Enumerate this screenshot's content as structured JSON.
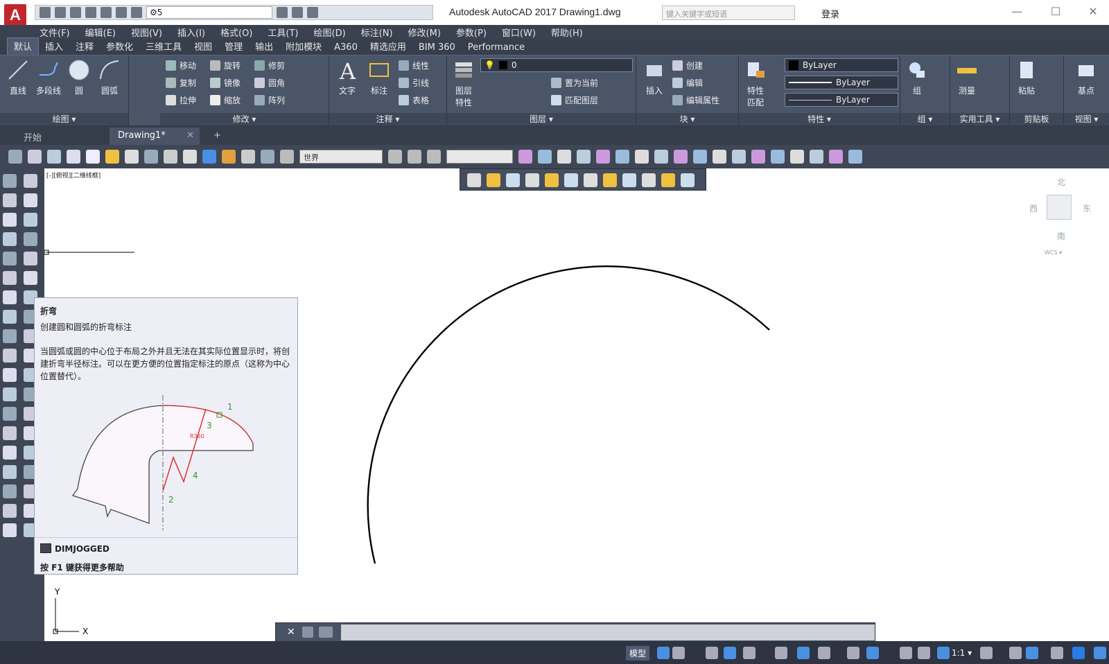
{
  "window": {
    "app_letter": "A",
    "title": "Autodesk AutoCAD 2017     Drawing1.dwg",
    "workspace": "5",
    "search_placeholder": "键入关键字或短语",
    "login": "登录",
    "min": "—",
    "max": "☐",
    "close": "✕"
  },
  "menus": [
    "文件(F)",
    "编辑(E)",
    "视图(V)",
    "插入(I)",
    "格式(O)",
    "工具(T)",
    "绘图(D)",
    "标注(N)",
    "修改(M)",
    "参数(P)",
    "窗口(W)",
    "帮助(H)"
  ],
  "ribbon_tabs": [
    "默认",
    "插入",
    "注释",
    "参数化",
    "三维工具",
    "视图",
    "管理",
    "输出",
    "附加模块",
    "A360",
    "精选应用",
    "BIM 360",
    "Performance"
  ],
  "ribbon": {
    "draw": {
      "title": "绘图 ▾",
      "line": "直线",
      "polyline": "多段线",
      "circle": "圆",
      "arc": "圆弧"
    },
    "modify": {
      "title": "修改 ▾",
      "move": "移动",
      "rotate": "旋转",
      "trim": "修剪",
      "copy": "复制",
      "mirror": "镜像",
      "fillet": "圆角",
      "stretch": "拉伸",
      "scale": "缩放",
      "array": "阵列"
    },
    "annotation": {
      "title": "注释 ▾",
      "text": "文字",
      "dimension": "标注",
      "linear": "线性",
      "leader": "引线",
      "table": "表格"
    },
    "layers": {
      "title": "图层 ▾",
      "layer_props": "图层\n特性",
      "current_layer": "0",
      "set_current": "置为当前",
      "match_layer": "匹配图层"
    },
    "block": {
      "title": "块 ▾",
      "insert": "插入",
      "create": "创建",
      "edit": "编辑",
      "edit_attr": "编辑属性"
    },
    "properties": {
      "title": "特性 ▾",
      "match": "特性\n匹配",
      "color": "ByLayer",
      "linetype": "ByLayer",
      "lineweight": "ByLayer"
    },
    "groups": {
      "title": "组 ▾",
      "group": "组"
    },
    "utilities": {
      "title": "实用工具 ▾",
      "measure": "测量"
    },
    "clipboard": {
      "title": "剪贴板",
      "paste": "粘贴"
    },
    "view": {
      "title": "视图 ▾",
      "base": "基点"
    }
  },
  "doc_tabs": {
    "start": "开始",
    "drawing": "Drawing1*",
    "close": "✕",
    "add": "+"
  },
  "toolbar": {
    "ucs_combo": "世界"
  },
  "viewport_label": "[-][俯视][二维线框]",
  "tooltip": {
    "title": "折弯",
    "subtitle": "创建圆和圆弧的折弯标注",
    "description": "当圆弧或圆的中心位于布局之外并且无法在其实际位置显示时，将创建折弯半径标注。可以在更方便的位置指定标注的原点（这称为中心位置替代）。",
    "label_1": "1",
    "label_2": "2",
    "label_3": "3",
    "label_4": "4",
    "dim_text": "R360",
    "command": "DIMJOGGED",
    "help": "按 F1 键获得更多帮助"
  },
  "compass": {
    "north": "北",
    "south": "南",
    "east": "东",
    "west": "西",
    "wcs": "WCS ▾"
  },
  "axes": {
    "y": "Y",
    "x": "X"
  },
  "statusbar": {
    "model": "模型",
    "scale": "1:1 ▾"
  },
  "colors": {
    "accent": "#c0272d",
    "ribbon": "#4a5568",
    "canvas": "#ffffff"
  }
}
